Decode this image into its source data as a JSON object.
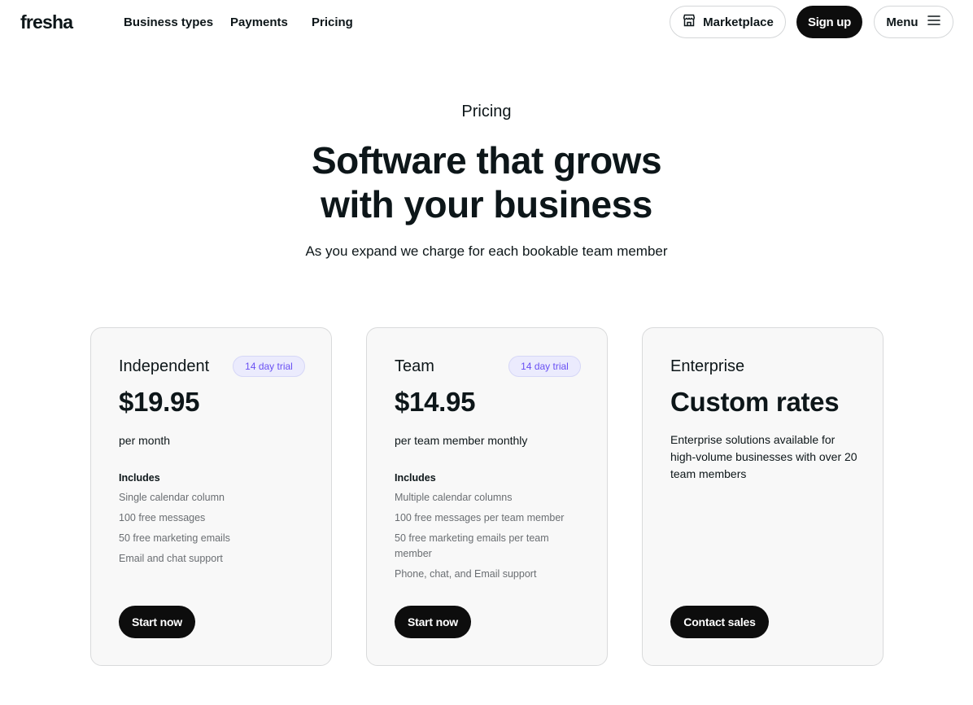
{
  "header": {
    "logo": "fresha",
    "nav": [
      "Business types",
      "Payments",
      "Pricing"
    ],
    "marketplace_label": "Marketplace",
    "signup_label": "Sign up",
    "menu_label": "Menu"
  },
  "hero": {
    "eyebrow": "Pricing",
    "headline_line1": "Software that grows",
    "headline_line2": "with your business",
    "subhead": "As you expand we charge for each bookable team member"
  },
  "plans": [
    {
      "name": "Independent",
      "badge": "14 day trial",
      "price": "$19.95",
      "period": "per month",
      "includes_title": "Includes",
      "features": [
        "Single calendar column",
        "100 free messages",
        "50 free marketing emails",
        "Email and chat support"
      ],
      "cta": "Start now"
    },
    {
      "name": "Team",
      "badge": "14 day trial",
      "price": "$14.95",
      "period": "per team member monthly",
      "includes_title": "Includes",
      "features": [
        "Multiple calendar columns",
        "100 free messages per team member",
        "50 free marketing emails per team member",
        "Phone, chat, and Email support"
      ],
      "cta": "Start now"
    },
    {
      "name": "Enterprise",
      "price": "Custom rates",
      "description": "Enterprise solutions available for high-volume businesses with over 20 team members",
      "cta": "Contact sales"
    }
  ],
  "colors": {
    "text": "#0d1619",
    "button_dark": "#0d0d0d",
    "card_bg": "#f8f8f8",
    "badge_bg": "#ebebfd",
    "badge_text": "#6950f3",
    "feature_text": "#6a6e72"
  },
  "icons": {
    "marketplace": "storefront-icon",
    "menu": "hamburger-menu-icon"
  }
}
